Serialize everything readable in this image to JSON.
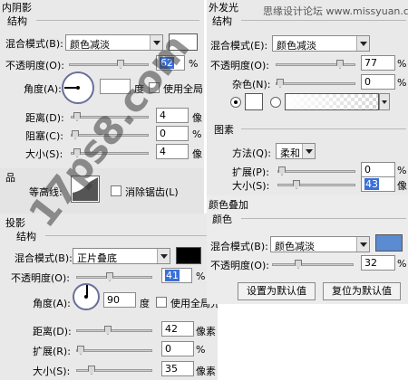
{
  "top_watermark": "思缘设计论坛 www.missyuan.com",
  "inner_shadow": {
    "title": "内阴影",
    "section": "结构",
    "blend_label": "混合模式(B):",
    "blend_value": "颜色减淡",
    "opacity_label": "不透明度(O):",
    "opacity_value": "62",
    "opacity_unit": "%",
    "angle_label": "角度(A):",
    "angle_unit": "度",
    "global_light_label": "使用全局",
    "distance_label": "距离(D):",
    "distance_value": "4",
    "distance_unit": "像",
    "choke_label": "阻塞(C):",
    "choke_value": "0",
    "choke_unit": "%",
    "size_label": "大小(S):",
    "size_value": "4",
    "size_unit": "像",
    "swatch_color": "#ffffff"
  },
  "quality": {
    "title": "品",
    "contour_label": "等高线:",
    "antialias_label": "消除锯齿(L)"
  },
  "drop_shadow": {
    "title": "投影",
    "section": "结构",
    "blend_label": "混合模式(B):",
    "blend_value": "正片叠底",
    "opacity_label": "不透明度(O):",
    "opacity_value": "41",
    "opacity_unit": "%",
    "angle_label": "角度(A):",
    "angle_value": "90",
    "angle_unit": "度",
    "global_light_label": "使用全局光",
    "distance_label": "距离(D):",
    "distance_value": "42",
    "distance_unit": "像素",
    "spread_label": "扩展(R):",
    "spread_value": "0",
    "spread_unit": "%",
    "size_label": "大小(S):",
    "size_value": "35",
    "size_unit": "像素",
    "swatch_color": "#000000"
  },
  "outer_glow": {
    "title": "外发光",
    "section": "结构",
    "blend_label": "混合模式(E):",
    "blend_value": "颜色减淡",
    "opacity_label": "不透明度(O):",
    "opacity_value": "77",
    "opacity_unit": "%",
    "noise_label": "杂色(N):",
    "noise_value": "0",
    "noise_unit": "%",
    "elements_title": "图素",
    "technique_label": "方法(Q):",
    "technique_value": "柔和",
    "spread_label": "扩展(P):",
    "spread_value": "0",
    "spread_unit": "%",
    "size_label": "大小(S):",
    "size_value": "43",
    "size_unit": "像",
    "swatch_color": "#ffffff"
  },
  "color_overlay": {
    "title": "颜色叠加",
    "section": "颜色",
    "blend_label": "混合模式(B):",
    "blend_value": "颜色减淡",
    "opacity_label": "不透明度(O):",
    "opacity_value": "32",
    "opacity_unit": "%",
    "swatch_color": "#5b8bd0",
    "set_default_label": "设置为默认值",
    "reset_default_label": "复位为默认值"
  },
  "watermark_text": "17ps8.com",
  "colors": {
    "panel_bg": "#e9e9e9",
    "highlight": "#3a6fd8",
    "overlay_blue": "#5b8bd0"
  }
}
